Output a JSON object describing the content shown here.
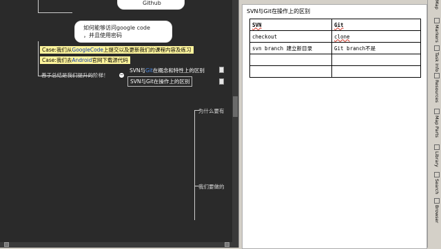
{
  "mindmap": {
    "github_text": "Github",
    "bubble_line1": "如何能够访问google code",
    "bubble_line2": "，并且使用密码",
    "case1_prefix": "Case:",
    "case1_text_a": "我们从",
    "case1_link": "GoogleCode",
    "case1_text_b": "上提交以及更新我们的课程内容及练习",
    "case2_prefix": "Case:",
    "case2_text_a": "我们去",
    "case2_link": "Android",
    "case2_text_b": "官网下载源代码",
    "summary_text": "善于总结是我们提升的阶梯！",
    "node1_a": "SVN与",
    "node1_b": "Git",
    "node1_c": "在概念和特性上的区别",
    "node2_a": "SVN与",
    "node2_b": "Git",
    "node2_c": "在操作上的区别",
    "why_text": "为什么要有",
    "todo_text": "我们要做的"
  },
  "document": {
    "title": "SVN与Git在操作上的区别",
    "headers": [
      "SVN",
      "Git"
    ],
    "rows": [
      [
        "checkout",
        "clone"
      ],
      [
        "svn branch 建立新目录",
        "Git branch不是"
      ],
      [
        "",
        ""
      ],
      [
        "",
        ""
      ]
    ]
  },
  "sidebar_tabs": [
    "Map",
    "Markers",
    "Task Info",
    "Resources",
    "Map Parts",
    "Library",
    "Search",
    "Browser"
  ],
  "colors": {
    "canvas_bg": "#2a2a2a",
    "case_bg": "#fff59d",
    "link_blue": "#4a8ae8"
  }
}
